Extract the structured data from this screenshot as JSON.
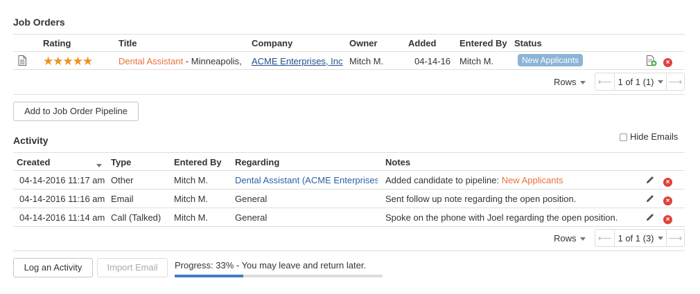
{
  "job_orders": {
    "title": "Job Orders",
    "columns": [
      "Rating",
      "Title",
      "Company",
      "Owner",
      "Added",
      "Entered By",
      "Status"
    ],
    "rating_stars": 5,
    "row": {
      "title_link": "Dental Assistant",
      "title_rest": " - Minneapolis, C",
      "company": "ACME Enterprises, Inc",
      "owner": "Mitch M.",
      "added": "04-14-16",
      "entered_by": "Mitch M.",
      "status": "New Applicants"
    },
    "rows_label": "Rows",
    "pager_text": "1 of 1 (1)"
  },
  "add_pipeline_button": "Add to Job Order Pipeline",
  "activity": {
    "title": "Activity",
    "hide_emails_label": "Hide Emails",
    "columns": [
      "Created",
      "Type",
      "Entered By",
      "Regarding",
      "Notes"
    ],
    "rows": [
      {
        "created": "04-14-2016 11:17 am",
        "type": "Other",
        "entered_by": "Mitch M.",
        "regarding_link": "Dental Assistant",
        "regarding_paren": " (ACME Enterprises, In",
        "notes_text": "Added candidate to pipeline: ",
        "notes_highlight": "New Applicants"
      },
      {
        "created": "04-14-2016 11:16 am",
        "type": "Email",
        "entered_by": "Mitch M.",
        "regarding_plain": "General",
        "notes_text": "Sent follow up note regarding the open position."
      },
      {
        "created": "04-14-2016 11:14 am",
        "type": "Call (Talked)",
        "entered_by": "Mitch M.",
        "regarding_plain": "General",
        "notes_text": "Spoke on the phone with Joel regarding the open position."
      }
    ],
    "rows_label": "Rows",
    "pager_text": "1 of 1 (3)"
  },
  "log_activity_button": "Log an Activity",
  "import_email_button": "Import Email",
  "progress": {
    "label": "Progress: 33% - You may leave and return later.",
    "value_percent": 33
  },
  "colors": {
    "accent_orange": "#e8713d",
    "link_blue": "#2a62a8",
    "badge_blue": "#8bb4d6",
    "delete_red": "#e0403c",
    "progress_blue": "#3f7fc4",
    "star_orange": "#f0901e"
  },
  "icons": {
    "document": "document-icon",
    "star": "star-icon",
    "add_file": "add-document-icon",
    "delete": "delete-icon",
    "edit": "pencil-icon",
    "sort": "sort-caret-icon"
  }
}
